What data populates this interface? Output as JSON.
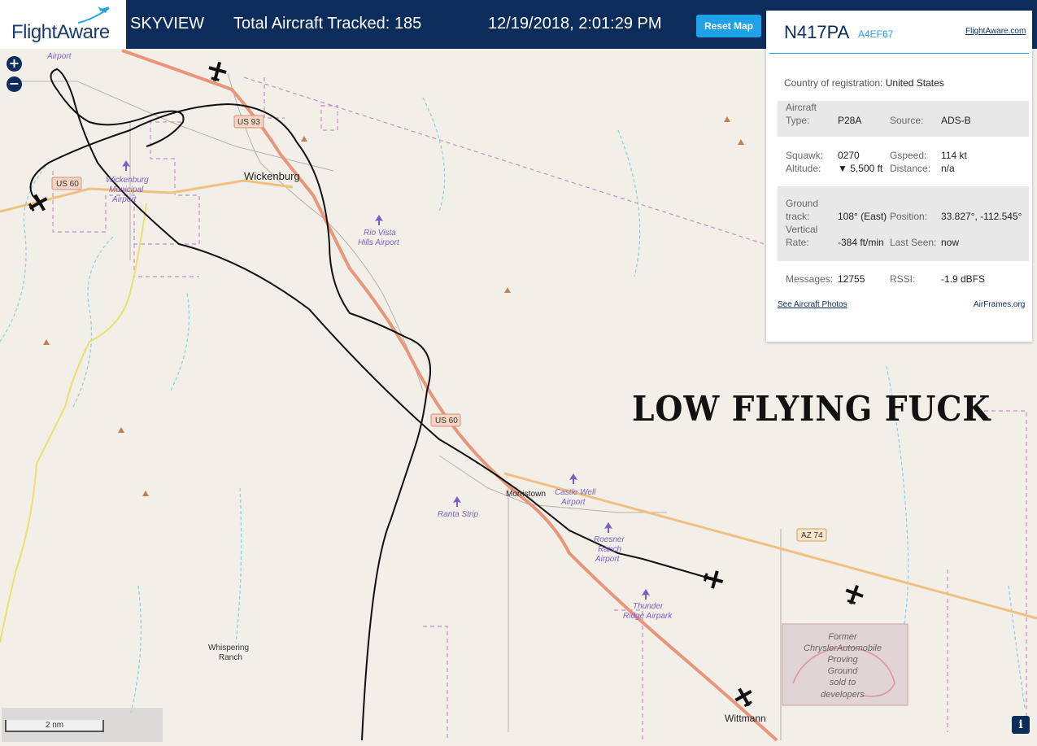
{
  "header": {
    "logo_text": "FlightAware",
    "app_name": "SKYVIEW",
    "total_tracked": "Total Aircraft Tracked: 185",
    "datetime": "12/19/2018, 2:01:29 PM",
    "reset_label": "Reset Map"
  },
  "panel": {
    "registration": "N417PA",
    "hex": "A4EF67",
    "fa_link": "FlightAware.com",
    "country_label": "Country of registration:",
    "country_value": "United States",
    "aircraft_label_1": "Aircraft",
    "aircraft_label_2": "Type:",
    "aircraft_type": "P28A",
    "source_label": "Source:",
    "source": "ADS-B",
    "squawk_label": "Squawk:",
    "squawk": "0270",
    "gspeed_label": "Gspeed:",
    "gspeed": "114 kt",
    "altitude_label": "Altitude:",
    "altitude": "▼ 5,500 ft",
    "distance_label": "Distance:",
    "distance": "n/a",
    "ground_label_1": "Ground",
    "ground_label_2": "track:",
    "ground_track": "108° (East)",
    "position_label": "Position:",
    "position": "33.827°, -112.545°",
    "vertical_label_1": "Vertical",
    "vertical_label_2": "Rate:",
    "vertical_rate": "-384 ft/min",
    "last_seen_label": "Last Seen:",
    "last_seen": "now",
    "messages_label": "Messages:",
    "messages": "12755",
    "rssi_label": "RSSI:",
    "rssi": "-1.9 dBFS",
    "photos_link": "See Aircraft Photos",
    "airframes_link": "AirFrames.org"
  },
  "map": {
    "zoom_in": "+",
    "zoom_out": "−",
    "scale_label": "2 nm",
    "info": "i",
    "caption": "LOW FLYING FUCK",
    "labels": {
      "airport_top": "Airport",
      "us93": "US 93",
      "wickenburg": "Wickenburg",
      "us60_west": "US 60",
      "wick_airport_1": "Wickenburg",
      "wick_airport_2": "Municipal",
      "wick_airport_3": "Airport",
      "rio_1": "Rio Vista",
      "rio_2": "Hills Airport",
      "us60_mid": "US 60",
      "morristown": "Morristown",
      "castle_1": "Castle Well",
      "castle_2": "Airport",
      "ranta": "Ranta Strip",
      "roesner_1": "Roesner",
      "roesner_2": "Ranch",
      "roesner_3": "Airport",
      "az74": "AZ 74",
      "thunder_1": "Thunder",
      "thunder_2": "Ridge Airpark",
      "whispering_1": "Whispering",
      "whispering_2": "Ranch",
      "former_1": "Former",
      "former_2": "ChryslerAutomobile",
      "former_3": "Proving",
      "former_4": "Ground",
      "former_5": "sold to",
      "former_6": "developers",
      "wittmann": "Wittmann"
    }
  },
  "colors": {
    "header_bg": "#0c2d5c",
    "accent": "#1ea1e6",
    "map_bg": "#f2efe9",
    "highway": "#e8957a",
    "state_route": "#f0c080",
    "track": "#111111",
    "airport_purple": "#7b5ec4"
  }
}
